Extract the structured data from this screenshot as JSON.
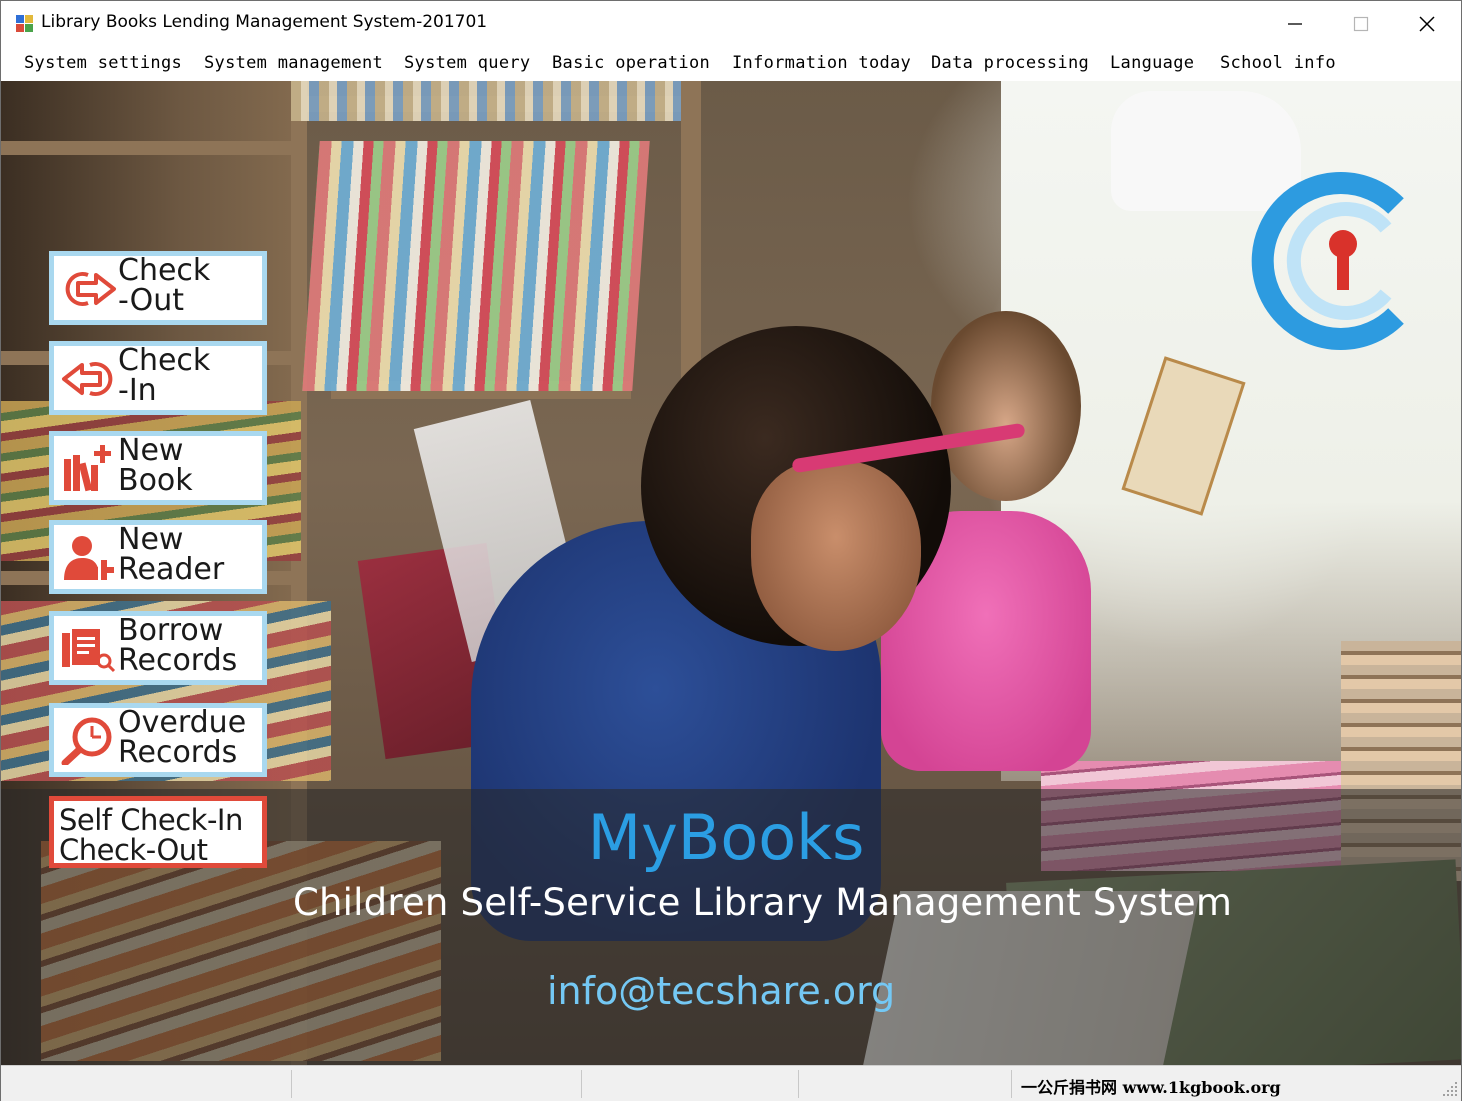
{
  "window": {
    "title": "Library Books Lending Management System-201701"
  },
  "menu": [
    {
      "label": "System settings"
    },
    {
      "label": "System management"
    },
    {
      "label": "System query"
    },
    {
      "label": "Basic operation"
    },
    {
      "label": "Information today"
    },
    {
      "label": "Data processing"
    },
    {
      "label": "Language"
    },
    {
      "label": "School info"
    }
  ],
  "actions": [
    {
      "label": "Check\n-Out",
      "icon": "check-out-icon"
    },
    {
      "label": "Check\n-In",
      "icon": "check-in-icon"
    },
    {
      "label": "New\nBook",
      "icon": "new-book-icon"
    },
    {
      "label": "New\nReader",
      "icon": "new-reader-icon"
    },
    {
      "label": "Borrow\nRecords",
      "icon": "borrow-records-icon"
    },
    {
      "label": "Overdue\nRecords",
      "icon": "overdue-records-icon"
    }
  ],
  "self_service": {
    "label": "Self Check-In\nCheck-Out"
  },
  "branding": {
    "title": "MyBooks",
    "subtitle": "Children Self-Service Library Management System",
    "email": "info@tecshare.org"
  },
  "statusbar": {
    "text": "一公斤捐书网  www.1kgbook.org"
  },
  "colors": {
    "accent_blue": "#2b9ee3",
    "icon_red": "#e04a3a",
    "button_border": "#a9d8ef",
    "email_color": "#74c8f4"
  }
}
